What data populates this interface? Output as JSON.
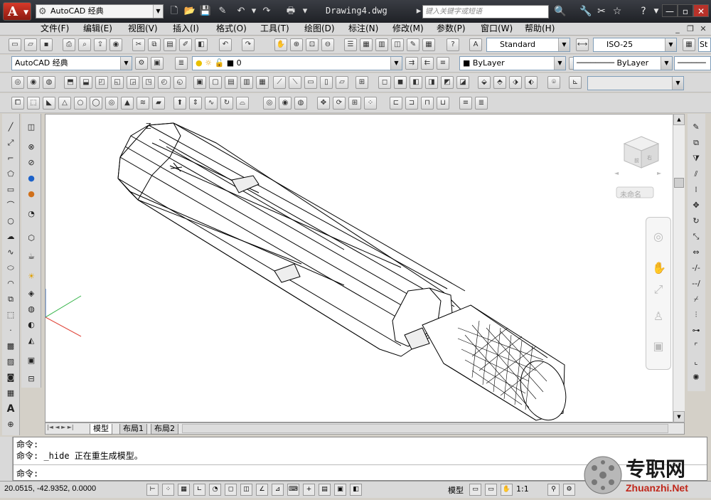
{
  "title_bar": {
    "workspace": "AutoCAD 经典",
    "doc_title": "Drawing4.dwg",
    "search_placeholder": "键入关键字或短语"
  },
  "menu": [
    "文件(F)",
    "编辑(E)",
    "视图(V)",
    "插入(I)",
    "格式(O)",
    "工具(T)",
    "绘图(D)",
    "标注(N)",
    "修改(M)",
    "参数(P)",
    "窗口(W)",
    "帮助(H)"
  ],
  "styles": {
    "text_style": "Standard",
    "dim_style": "ISO-25",
    "table_style": "St"
  },
  "layers": {
    "workspace": "AutoCAD 经典",
    "current_layer": "0",
    "color": "ByLayer",
    "linetype": "ByLayer"
  },
  "viewcube": {
    "named_view": "未命名"
  },
  "layout_tabs": [
    "模型",
    "布局1",
    "布局2"
  ],
  "command_lines": [
    "命令:",
    "命令: _hide 正在重生成模型。",
    "命令:"
  ],
  "status": {
    "coords": "20.0515, -42.9352, 0.0000",
    "model_label": "模型",
    "scale": "1:1"
  },
  "watermark": {
    "text_cn": "专职网",
    "text_en": "Zhuanzhi.Net"
  },
  "colors": {
    "accent": "#c0271b",
    "titlebar": "#2a2c31",
    "ucs_x": "#e0473b",
    "ucs_y": "#31b245"
  }
}
